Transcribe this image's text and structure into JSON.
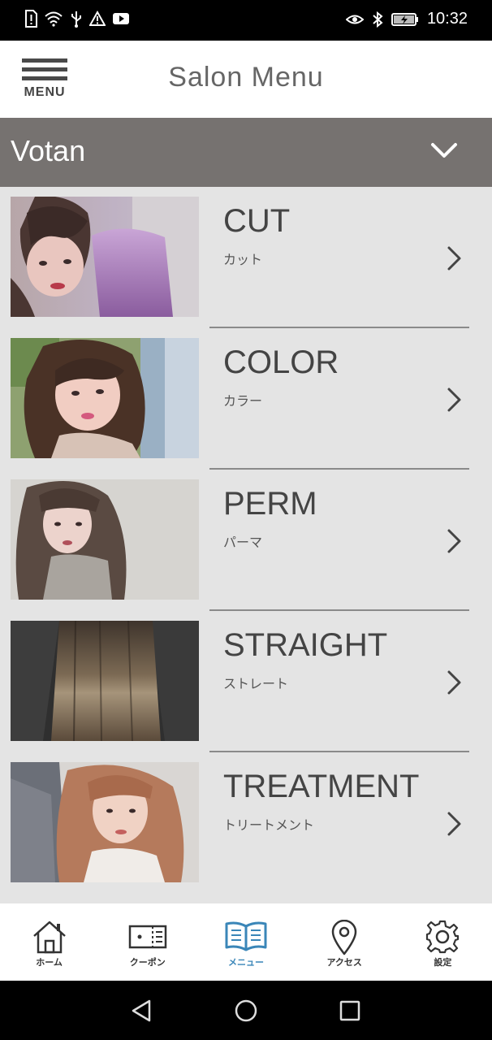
{
  "status_bar": {
    "time": "10:32",
    "left_icons": [
      "sim-alert-icon",
      "wifi-icon",
      "usb-icon",
      "warning-icon",
      "youtube-icon"
    ],
    "right_icons": [
      "eye-icon",
      "bluetooth-icon",
      "battery-charging-icon"
    ]
  },
  "header": {
    "menu_label": "MENU",
    "title": "Salon Menu"
  },
  "salon_selector": {
    "name": "Votan",
    "icon": "chevron-down-icon"
  },
  "menu": {
    "items": [
      {
        "title": "CUT",
        "subtitle": "カット"
      },
      {
        "title": "COLOR",
        "subtitle": "カラー"
      },
      {
        "title": "PERM",
        "subtitle": "パーマ"
      },
      {
        "title": "STRAIGHT",
        "subtitle": "ストレート"
      },
      {
        "title": "TREATMENT",
        "subtitle": "トリートメント"
      }
    ]
  },
  "bottom_nav": {
    "active_color": "#3a86b8",
    "items": [
      {
        "label": "ホーム",
        "icon": "home-icon"
      },
      {
        "label": "クーポン",
        "icon": "coupon-icon"
      },
      {
        "label": "メニュー",
        "icon": "book-icon",
        "active": true
      },
      {
        "label": "アクセス",
        "icon": "location-pin-icon"
      },
      {
        "label": "設定",
        "icon": "gear-icon"
      }
    ]
  },
  "system_nav": {
    "buttons": [
      "back-icon",
      "home-circle-icon",
      "recents-icon"
    ]
  },
  "colors": {
    "salon_bar": "#767270",
    "list_background": "#e4e4e4",
    "accent": "#3a86b8"
  }
}
